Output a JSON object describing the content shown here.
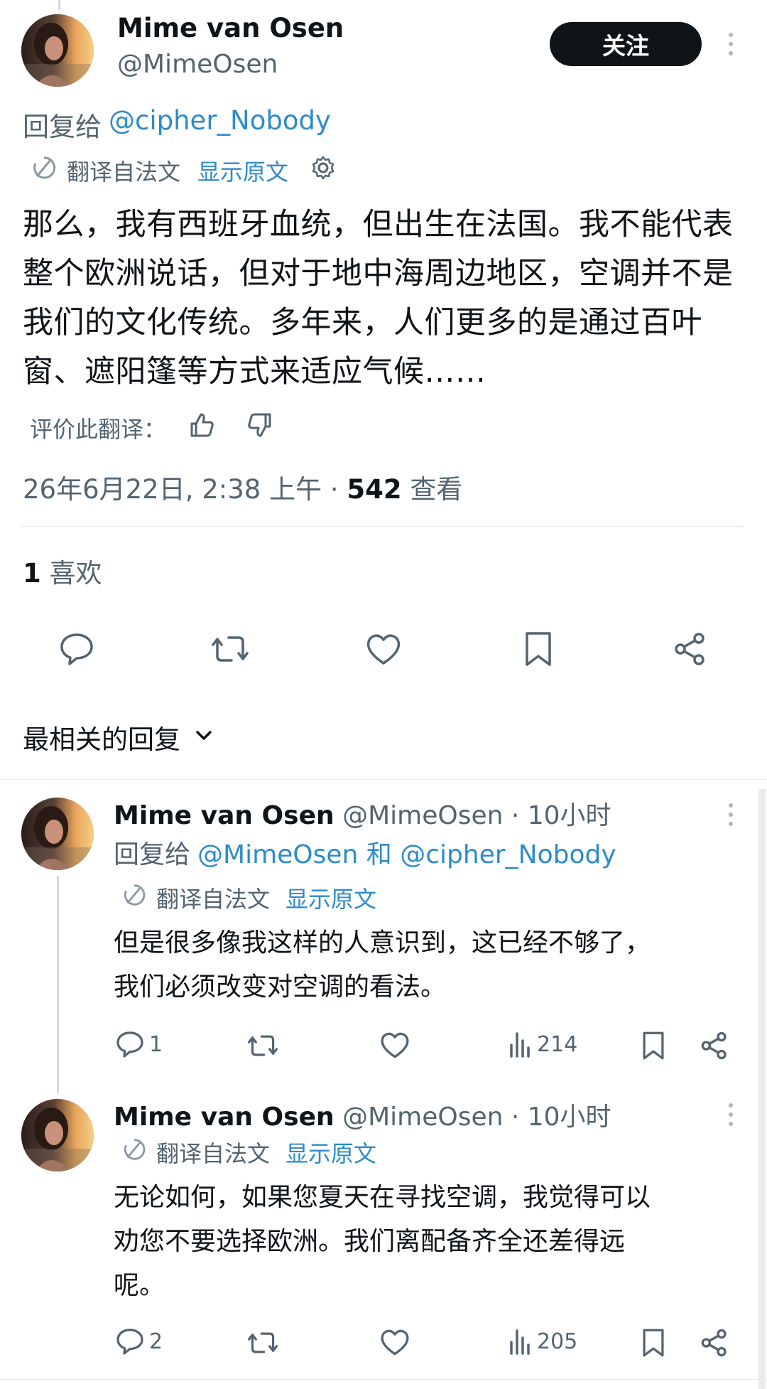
{
  "main_tweet": {
    "author_name": "Mime van Osen",
    "handle": "@MimeOsen",
    "follow_label": "关注",
    "reply_prefix": "回复给",
    "reply_to": "@cipher_Nobody",
    "translated_from": "翻译自法文",
    "show_original": "显示原文",
    "text": "那么，我有西班牙血统，但出生在法国。我不能代表整个欧洲说话，但对于地中海周边地区，空调并不是我们的文化传统。多年来，人们更多的是通过百叶窗、遮阳篷等方式来适应气候……",
    "rate_translation": "评价此翻译：",
    "datetime": "26年6月22日, 2:38 上午 · ",
    "views_count": "542",
    "views_label": " 查看",
    "likes_count": "1",
    "likes_label": " 喜欢"
  },
  "sort": {
    "label": "最相关的回复"
  },
  "replies": [
    {
      "author_name": "Mime van Osen",
      "handle_time": "@MimeOsen · 10小时",
      "reply_prefix": "回复给",
      "reply_to": "@MimeOsen 和 @cipher_Nobody",
      "translated_from": "翻译自法文",
      "show_original": "显示原文",
      "text_line1": "但是很多像我这样的人意识到，这已经不够了，",
      "text_line2": "我们必须改变对空调的看法。",
      "reply_count": "1",
      "view_count": "214"
    },
    {
      "author_name": "Mime van Osen",
      "handle_time": "@MimeOsen · 10小时",
      "translated_from": "翻译自法文",
      "show_original": "显示原文",
      "text_line1": "无论如何，如果您夏天在寻找空调，我觉得可以",
      "text_line2": "劝您不要选择欧洲。我们离配备齐全还差得远",
      "text_line3": "呢。",
      "reply_count": "2",
      "view_count": "205"
    }
  ],
  "icons": {
    "translate": "translate-icon",
    "settings": "gear-icon",
    "thumb_up": "thumbs-up-icon",
    "thumb_down": "thumbs-down-icon",
    "reply": "reply-icon",
    "retweet": "retweet-icon",
    "like": "heart-icon",
    "bookmark": "bookmark-icon",
    "share": "share-icon",
    "views": "views-icon",
    "more": "more-icon",
    "chevron": "chevron-down-icon"
  },
  "colors": {
    "link": "#2e8bc9",
    "text": "#0f1419",
    "muted": "#536471",
    "button_bg": "#0f1419"
  }
}
